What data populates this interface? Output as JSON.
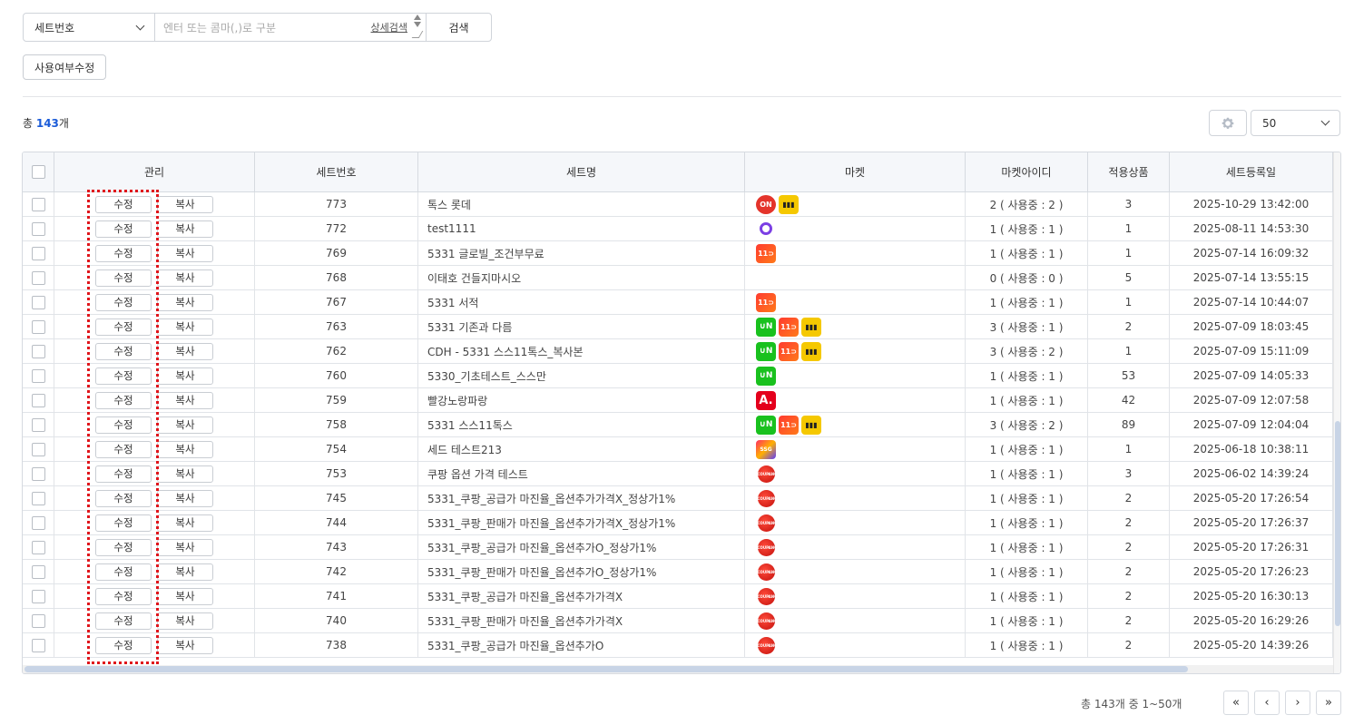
{
  "search": {
    "select_value": "세트번호",
    "placeholder": "엔터 또는 콤마(,)로 구분",
    "detail_link": "상세검색",
    "button": "검색"
  },
  "toolbar": {
    "usage_button": "사용여부수정"
  },
  "summary": {
    "total_prefix": "총 ",
    "total_count": "143",
    "total_suffix": "개"
  },
  "page_size": "50",
  "table": {
    "headers": [
      "관리",
      "세트번호",
      "세트명",
      "마켓",
      "마켓아이디",
      "적용상품",
      "세트등록일"
    ],
    "edit_label": "수정",
    "copy_label": "복사",
    "rows": [
      {
        "no": "773",
        "name": "톡스 롯데",
        "markets": [
          "on",
          "lotte"
        ],
        "market_id": "2 ( 사용중 : 2 )",
        "count": "3",
        "date": "2025-10-29 13:42:00"
      },
      {
        "no": "772",
        "name": "test1111",
        "markets": [
          "o"
        ],
        "market_id": "1 ( 사용중 : 1 )",
        "count": "1",
        "date": "2025-08-11 14:53:30"
      },
      {
        "no": "769",
        "name": "5331 글로빌_조건부무료",
        "markets": [
          "11st"
        ],
        "market_id": "1 ( 사용중 : 1 )",
        "count": "1",
        "date": "2025-07-14 16:09:32"
      },
      {
        "no": "768",
        "name": "이태호 건들지마시오",
        "markets": [],
        "market_id": "0 ( 사용중 : 0 )",
        "count": "5",
        "date": "2025-07-14 13:55:15"
      },
      {
        "no": "767",
        "name": "5331 서적",
        "markets": [
          "11st"
        ],
        "market_id": "1 ( 사용중 : 1 )",
        "count": "1",
        "date": "2025-07-14 10:44:07"
      },
      {
        "no": "763",
        "name": "5331 기존과 다름",
        "markets": [
          "naver",
          "11st",
          "lotte"
        ],
        "market_id": "3 ( 사용중 : 1 )",
        "count": "2",
        "date": "2025-07-09 18:03:45"
      },
      {
        "no": "762",
        "name": "CDH - 5331 스스11톡스_복사본",
        "markets": [
          "naver",
          "11st",
          "lotte"
        ],
        "market_id": "3 ( 사용중 : 2 )",
        "count": "1",
        "date": "2025-07-09 15:11:09"
      },
      {
        "no": "760",
        "name": "5330_기초테스트_스스만",
        "markets": [
          "naver"
        ],
        "market_id": "1 ( 사용중 : 1 )",
        "count": "53",
        "date": "2025-07-09 14:05:33"
      },
      {
        "no": "759",
        "name": "빨강노랑파랑",
        "markets": [
          "auction"
        ],
        "market_id": "1 ( 사용중 : 1 )",
        "count": "42",
        "date": "2025-07-09 12:07:58"
      },
      {
        "no": "758",
        "name": "5331 스스11톡스",
        "markets": [
          "naver",
          "11st",
          "lotte"
        ],
        "market_id": "3 ( 사용중 : 2 )",
        "count": "89",
        "date": "2025-07-09 12:04:04"
      },
      {
        "no": "754",
        "name": "세드 테스트213",
        "markets": [
          "ssg"
        ],
        "market_id": "1 ( 사용중 : 1 )",
        "count": "1",
        "date": "2025-06-18 10:38:11"
      },
      {
        "no": "753",
        "name": "쿠팡 옵션 가격 테스트",
        "markets": [
          "coupang"
        ],
        "market_id": "1 ( 사용중 : 1 )",
        "count": "3",
        "date": "2025-06-02 14:39:24"
      },
      {
        "no": "745",
        "name": "5331_쿠팡_공급가 마진율_옵션추가가격X_정상가1%",
        "markets": [
          "coupang"
        ],
        "market_id": "1 ( 사용중 : 1 )",
        "count": "2",
        "date": "2025-05-20 17:26:54"
      },
      {
        "no": "744",
        "name": "5331_쿠팡_판매가 마진율_옵션추가가격X_정상가1%",
        "markets": [
          "coupang"
        ],
        "market_id": "1 ( 사용중 : 1 )",
        "count": "2",
        "date": "2025-05-20 17:26:37"
      },
      {
        "no": "743",
        "name": "5331_쿠팡_공급가 마진율_옵션추가O_정상가1%",
        "markets": [
          "coupang"
        ],
        "market_id": "1 ( 사용중 : 1 )",
        "count": "2",
        "date": "2025-05-20 17:26:31"
      },
      {
        "no": "742",
        "name": "5331_쿠팡_판매가 마진율_옵션추가O_정상가1%",
        "markets": [
          "coupang"
        ],
        "market_id": "1 ( 사용중 : 1 )",
        "count": "2",
        "date": "2025-05-20 17:26:23"
      },
      {
        "no": "741",
        "name": "5331_쿠팡_공급가 마진율_옵션추가가격X",
        "markets": [
          "coupang"
        ],
        "market_id": "1 ( 사용중 : 1 )",
        "count": "2",
        "date": "2025-05-20 16:30:13"
      },
      {
        "no": "740",
        "name": "5331_쿠팡_판매가 마진율_옵션추가가격X",
        "markets": [
          "coupang"
        ],
        "market_id": "1 ( 사용중 : 1 )",
        "count": "2",
        "date": "2025-05-20 16:29:26"
      },
      {
        "no": "738",
        "name": "5331_쿠팡_공급가 마진율_옵션추가O",
        "markets": [
          "coupang"
        ],
        "market_id": "1 ( 사용중 : 1 )",
        "count": "2",
        "date": "2025-05-20 14:39:26"
      }
    ]
  },
  "market_icons": {
    "on": "ON",
    "lotte": "▮▮▮",
    "11st": "11⊃",
    "naver": "∪N",
    "auction": "A.",
    "ssg": "SSG",
    "coupang": "COUPANG"
  },
  "pagination": {
    "info": "총 143개 중 1~50개",
    "first": "«",
    "prev": "‹",
    "next": "›",
    "last": "»"
  },
  "colors": {
    "accent": "#1a5bd8",
    "highlight": "#e0151b",
    "header_bg": "#f5f7fa"
  }
}
